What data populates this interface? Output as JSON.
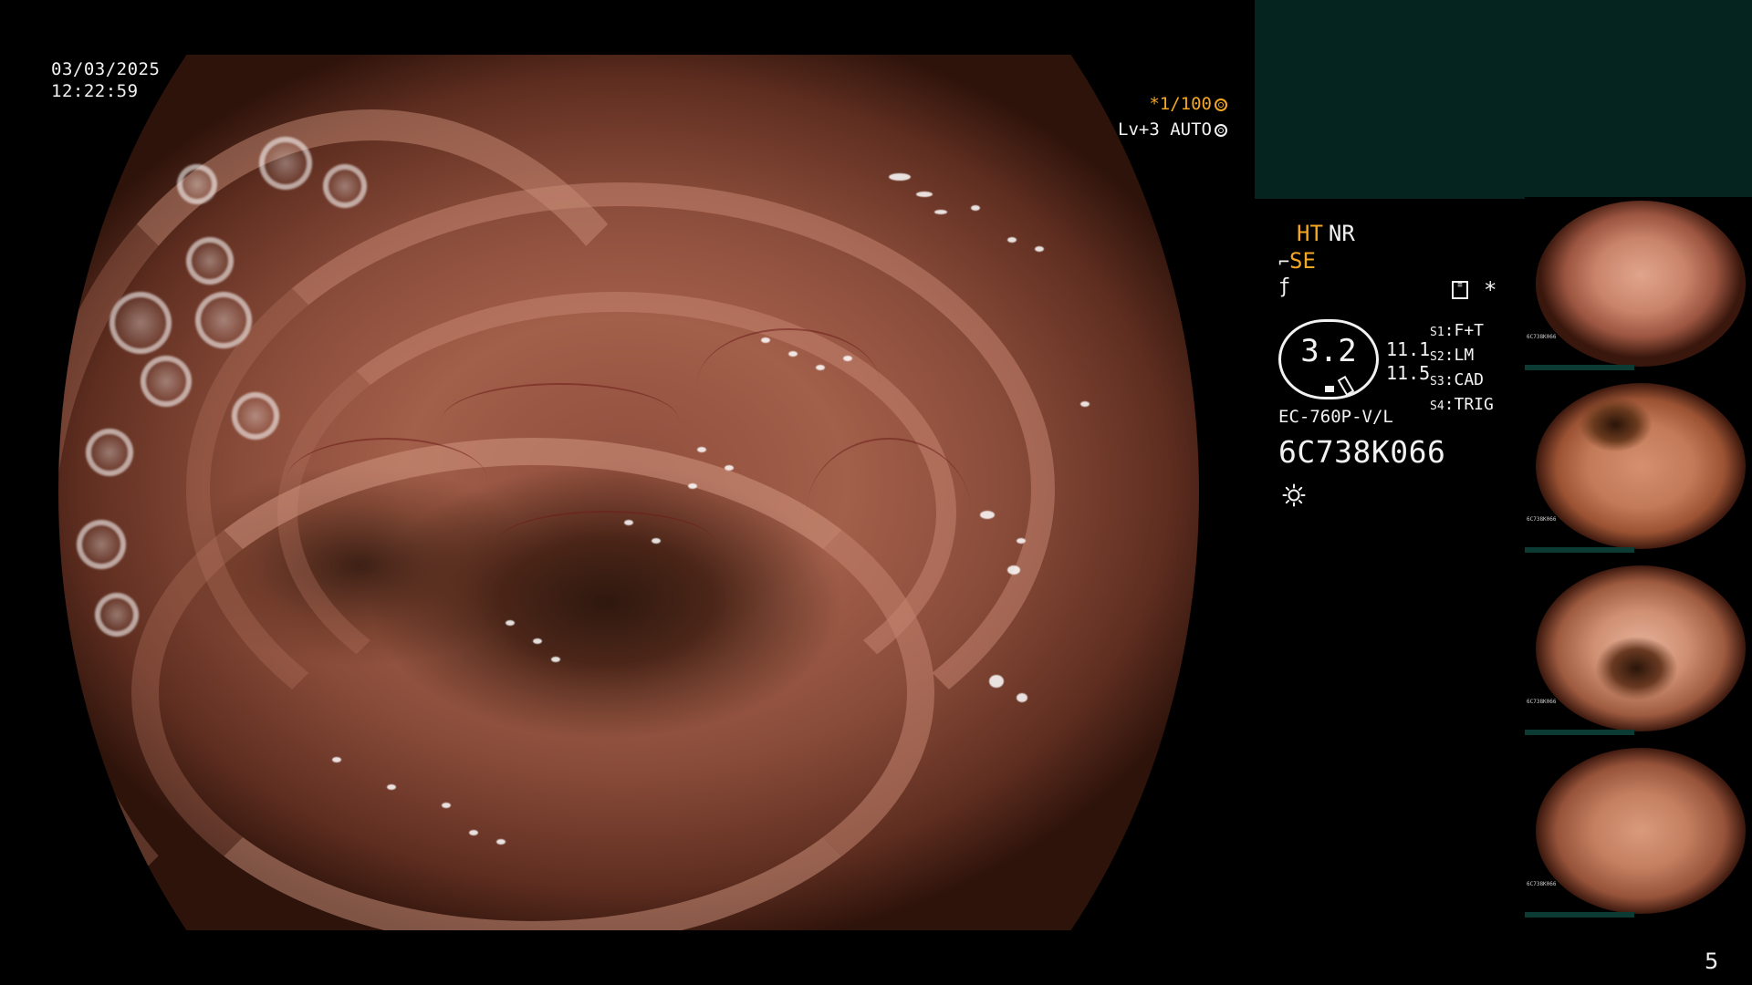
{
  "overlay": {
    "date": "03/03/2025",
    "time": "12:22:59",
    "shutter": "*1/100",
    "level": "Lv+3 AUTO"
  },
  "panel": {
    "flag_ht": "HT",
    "flag_nr": "NR",
    "flag_se": "SE",
    "zoom": "3.2",
    "value_1": "11.1",
    "value_2": "11.5",
    "switches": [
      {
        "key": "S1",
        "value": "F+T"
      },
      {
        "key": "S2",
        "value": "LM"
      },
      {
        "key": "S3",
        "value": "CAD"
      },
      {
        "key": "S4",
        "value": "TRIG"
      }
    ],
    "scope_model": "EC-760P-V/L",
    "serial": "6C738K066"
  },
  "thumbnails": {
    "count": 4,
    "caption": "6C738K066"
  },
  "page_number": "5",
  "colors": {
    "accent_orange": "#f5a623",
    "panel_teal": "#05241f",
    "text_white": "#f2f2f2"
  }
}
